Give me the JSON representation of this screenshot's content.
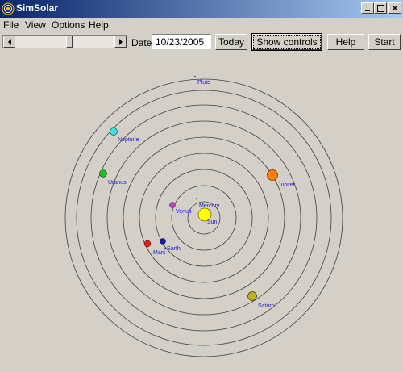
{
  "window": {
    "title": "SimSolar"
  },
  "menu": [
    {
      "label": "File"
    },
    {
      "label": "View"
    },
    {
      "label": "Options"
    },
    {
      "label": "Help"
    }
  ],
  "toolbar": {
    "date_label": "Date",
    "date_value": "10/23/2005",
    "today_label": "Today",
    "show_controls_label": "Show controls",
    "help_label": "Help",
    "start_label": "Start"
  },
  "system": {
    "orbit_color": "#404040",
    "bodies": [
      {
        "id": "sun",
        "label": "Sun",
        "color": "#ffff00"
      },
      {
        "id": "mercury",
        "label": "Mercury",
        "color": "#808080"
      },
      {
        "id": "venus",
        "label": "Venus",
        "color": "#c040c0"
      },
      {
        "id": "earth",
        "label": "Earth",
        "color": "#1a1aa0"
      },
      {
        "id": "mars",
        "label": "Mars",
        "color": "#e02020"
      },
      {
        "id": "jupiter",
        "label": "Jupiter",
        "color": "#ff8000"
      },
      {
        "id": "saturn",
        "label": "Saturn",
        "color": "#c0b020"
      },
      {
        "id": "uranus",
        "label": "Uranus",
        "color": "#20c020"
      },
      {
        "id": "neptune",
        "label": "Neptune",
        "color": "#40e0e0"
      },
      {
        "id": "pluto",
        "label": "Pluto",
        "color": "#606060"
      }
    ]
  }
}
